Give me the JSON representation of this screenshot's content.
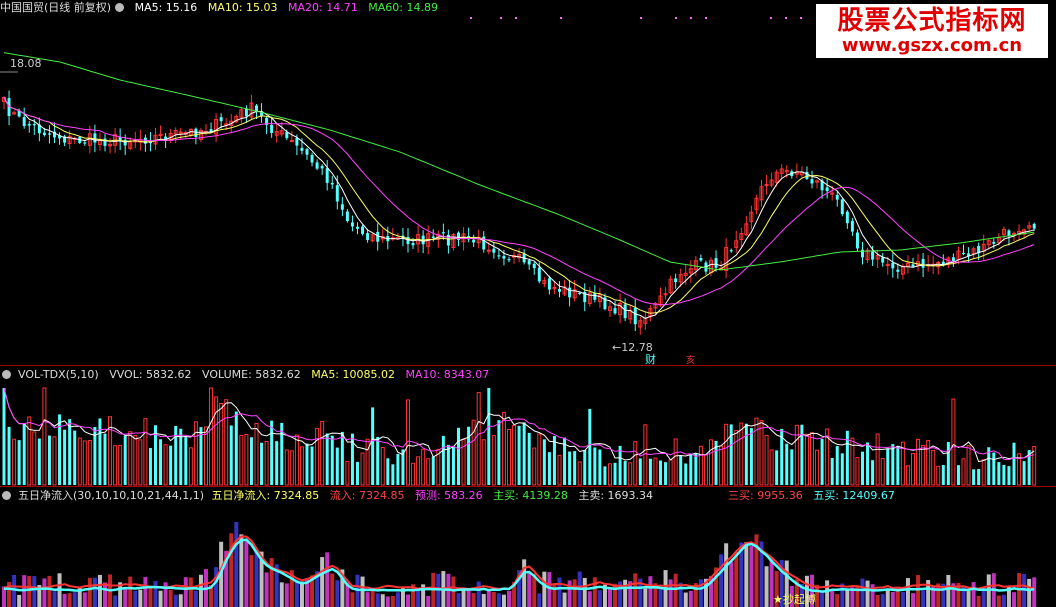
{
  "price_panel": {
    "title": "中国国贸(日线 前复权)",
    "ma5": {
      "label": "MA5: 15.16",
      "color": "#ffffff"
    },
    "ma10": {
      "label": "MA10: 15.03",
      "color": "#ffff66"
    },
    "ma20": {
      "label": "MA20: 14.71",
      "color": "#ff44ff"
    },
    "ma60": {
      "label": "MA60: 14.89",
      "color": "#44ee44"
    },
    "high_label": "18.08",
    "low_label": "12.78",
    "marker_cai": "财",
    "marker_2": "亥"
  },
  "watermark": {
    "line1": "股票公式指标网",
    "line2": "www.gszx.com.cn"
  },
  "volume_panel": {
    "name": "VOL-TDX(5,10)",
    "vvol": "VVOL: 5832.62",
    "volume": "VOLUME: 5832.62",
    "ma5": "MA5: 10085.02",
    "ma10": "MA10: 8343.07"
  },
  "flow_panel": {
    "name": "五日净流入(30,10,10,10,21,44,1,1)",
    "net_inflow": "五日净流入: 7324.85",
    "inflow": "流入: 7324.85",
    "predict": "预测: 583.26",
    "main_buy": "主买: 4139.28",
    "main_sell": "主卖: 1693.34",
    "three_buy": "三买: 9955.36",
    "five_buy": "五买: 12409.67",
    "bottom_tag": "★抄起博"
  },
  "colors": {
    "up": "#ff3333",
    "down": "#54ffff",
    "bg": "#000000",
    "separator": "#a00000"
  }
}
